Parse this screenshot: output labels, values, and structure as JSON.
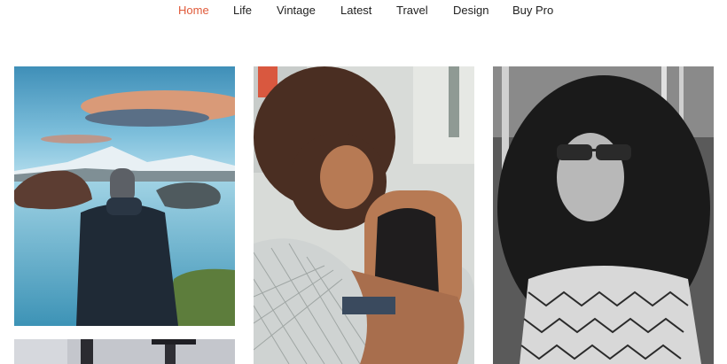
{
  "nav": {
    "items": [
      {
        "label": "Home",
        "active": true
      },
      {
        "label": "Life",
        "active": false
      },
      {
        "label": "Vintage",
        "active": false
      },
      {
        "label": "Latest",
        "active": false
      },
      {
        "label": "Travel",
        "active": false
      },
      {
        "label": "Design",
        "active": false
      },
      {
        "label": "Buy Pro",
        "active": false
      }
    ]
  },
  "colors": {
    "accent": "#e05a3a",
    "nav_text": "#222222",
    "background": "#ffffff"
  },
  "gallery": {
    "photos": [
      {
        "subject": "man with backpack looking at mountain lake"
      },
      {
        "subject": "woman with curly hair sitting in wire chair"
      },
      {
        "subject": "black and white portrait of woman with sunglasses"
      },
      {
        "subject": "partially visible photo"
      }
    ]
  }
}
